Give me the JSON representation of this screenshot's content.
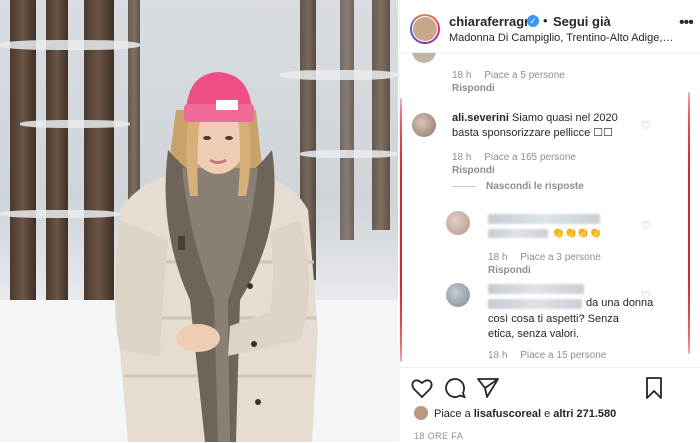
{
  "post": {
    "username": "chiaraferragni",
    "verified_mark": "✓",
    "separator": "•",
    "follow_label": "Segui già",
    "location": "Madonna Di Campiglio, Trentino-Alto Adige, I...",
    "more_label": "•••"
  },
  "comments": [
    {
      "kind": "top-partial",
      "time": "18 h",
      "likes": "Piace a 5 persone",
      "reply_label": "Rispondi"
    },
    {
      "kind": "comment",
      "username": "ali.severini",
      "text_line1": "Siamo quasi nel 2020",
      "text_line2": "basta sponsorizzare pellicce ☐☐",
      "time": "18 h",
      "likes": "Piace a 165 persone",
      "reply_label": "Rispondi"
    },
    {
      "kind": "reply",
      "text": "👏👏👏👏",
      "time": "18 h",
      "likes": "Piace a 3 persone",
      "reply_label": "Rispondi"
    },
    {
      "kind": "reply",
      "text_line1": "da una donna",
      "text_line2": "così cosa ti aspetti? Senza",
      "text_line3": "etica, senza valori.",
      "time": "18 h",
      "likes": "Piace a 15 persone"
    }
  ],
  "hide_replies_label": "Nascondi le risposte",
  "likes_summary": {
    "prefix": "Piace a ",
    "user": "lisafuscoreal",
    "middle": " e ",
    "others": "altri 271.580"
  },
  "timestamp": "18 ORE FA",
  "icons": {
    "like": "heart-icon",
    "comment": "comment-icon",
    "share": "share-icon",
    "save": "bookmark-icon"
  },
  "colors": {
    "verified": "#3897f0",
    "annotation": "#d8232a",
    "beanie": "#ee4f86",
    "muted_text": "#8e8e8e"
  }
}
